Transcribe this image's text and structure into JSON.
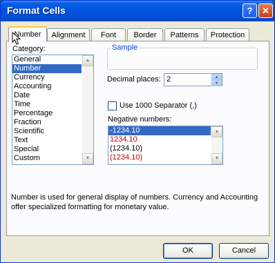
{
  "window": {
    "title": "Format Cells",
    "help_glyph": "?",
    "close_glyph": "✕"
  },
  "tabs": [
    {
      "label": "Number",
      "active": true
    },
    {
      "label": "Alignment"
    },
    {
      "label": "Font"
    },
    {
      "label": "Border"
    },
    {
      "label": "Patterns"
    },
    {
      "label": "Protection"
    }
  ],
  "category": {
    "label": "Category:",
    "items": [
      "General",
      "Number",
      "Currency",
      "Accounting",
      "Date",
      "Time",
      "Percentage",
      "Fraction",
      "Scientific",
      "Text",
      "Special",
      "Custom"
    ],
    "selected": "Number"
  },
  "sample": {
    "label": "Sample",
    "value": ""
  },
  "decimal_places": {
    "label": "Decimal places:",
    "value": "2"
  },
  "separator": {
    "label": "Use 1000 Separator (,)",
    "checked": false
  },
  "negative_numbers": {
    "label": "Negative numbers:",
    "items": [
      "-1234.10",
      "1234.10",
      "(1234.10)",
      "(1234.10)"
    ],
    "selected_index": 0
  },
  "description": "Number is used for general display of numbers.  Currency and Accounting offer specialized formatting for monetary value.",
  "buttons": {
    "ok": "OK",
    "cancel": "Cancel"
  },
  "colors": {
    "title_bar": "#0054e3",
    "selection": "#316ac5",
    "negative_red": "#c00000",
    "group_title": "#0046d5"
  },
  "icons": [
    "help-icon",
    "close-icon",
    "arrow-up-icon",
    "arrow-down-icon",
    "mouse-cursor-icon"
  ]
}
